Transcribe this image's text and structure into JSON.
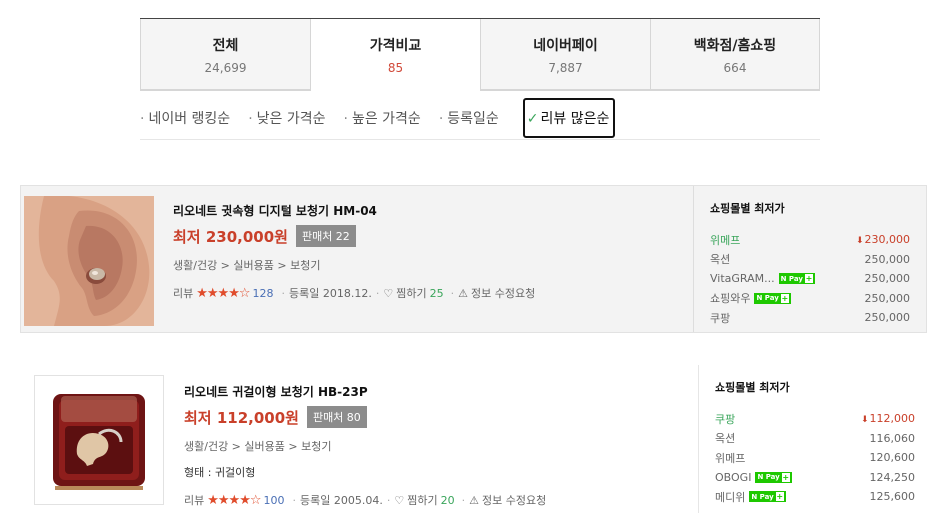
{
  "tabs": [
    {
      "label": "전체",
      "count": "24,699"
    },
    {
      "label": "가격비교",
      "count": "85"
    },
    {
      "label": "네이버페이",
      "count": "7,887"
    },
    {
      "label": "백화점/홈쇼핑",
      "count": "664"
    }
  ],
  "sort": {
    "items": [
      "네이버 랭킹순",
      "낮은 가격순",
      "높은 가격순",
      "등록일순"
    ],
    "active": "리뷰 많은순"
  },
  "products": [
    {
      "name": "리오네트 귓속형 디지털 보청기 HM-04",
      "price": "최저 230,000원",
      "sellers": "판매처 22",
      "category": "생활/건강 > 실버용품 > 보청기",
      "review_label": "리뷰",
      "stars": "★★★★☆",
      "review_count": "128",
      "registered": "등록일 2018.12.",
      "wish_label": "찜하기",
      "wish_count": "25",
      "report": "정보 수정요청",
      "mall_title": "쇼핑몰별 최저가",
      "malls": [
        {
          "name": "위메프",
          "price": "230,000",
          "npay": false
        },
        {
          "name": "옥션",
          "price": "250,000",
          "npay": false
        },
        {
          "name": "VitaGRAM...",
          "price": "250,000",
          "npay": true
        },
        {
          "name": "쇼핑와우",
          "price": "250,000",
          "npay": true
        },
        {
          "name": "쿠팡",
          "price": "250,000",
          "npay": false
        }
      ]
    },
    {
      "name": "리오네트 귀걸이형 보청기 HB-23P",
      "price": "최저 112,000원",
      "sellers": "판매처 80",
      "category": "생활/건강 > 실버용품 > 보청기",
      "spec": "형태 : 귀걸이형",
      "review_label": "리뷰",
      "stars": "★★★★☆",
      "review_count": "100",
      "registered": "등록일 2005.04.",
      "wish_label": "찜하기",
      "wish_count": "20",
      "report": "정보 수정요청",
      "mall_title": "쇼핑몰별 최저가",
      "malls": [
        {
          "name": "쿠팡",
          "price": "112,000",
          "npay": false
        },
        {
          "name": "옥션",
          "price": "116,060",
          "npay": false
        },
        {
          "name": "위메프",
          "price": "120,600",
          "npay": false
        },
        {
          "name": "OBOGI",
          "price": "124,250",
          "npay": true
        },
        {
          "name": "메디위",
          "price": "125,600",
          "npay": true
        }
      ]
    }
  ],
  "npay_label": "N Pay",
  "npay_plus": "+",
  "colors": {
    "price": "#c9402a",
    "accent": "#3aa55b",
    "npay": "#1ec800",
    "review": "#4a6fb5"
  }
}
